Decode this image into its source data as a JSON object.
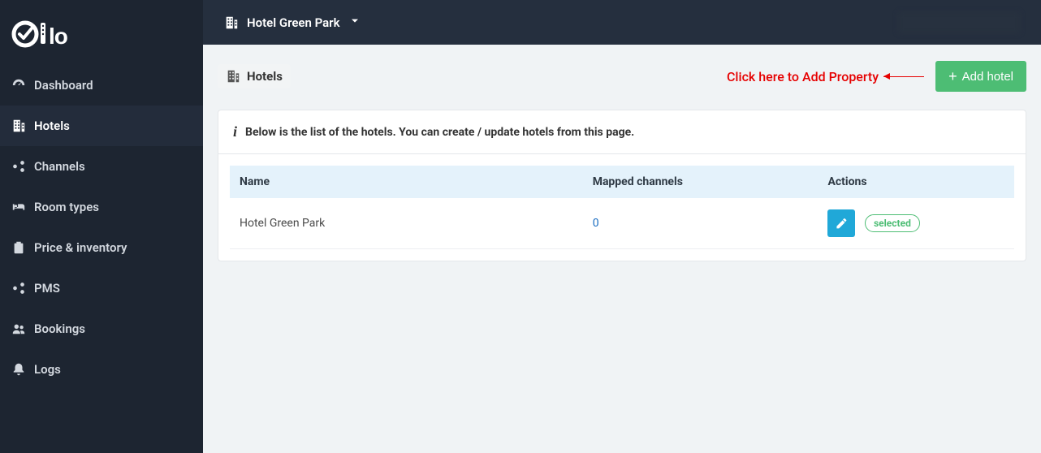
{
  "sidebar": {
    "items": [
      {
        "label": "Dashboard",
        "icon": "dashboard-icon"
      },
      {
        "label": "Hotels",
        "icon": "building-icon",
        "active": true
      },
      {
        "label": "Channels",
        "icon": "share-icon"
      },
      {
        "label": "Room types",
        "icon": "bed-icon"
      },
      {
        "label": "Price & inventory",
        "icon": "clipboard-icon"
      },
      {
        "label": "PMS",
        "icon": "share-icon"
      },
      {
        "label": "Bookings",
        "icon": "people-icon"
      },
      {
        "label": "Logs",
        "icon": "bell-icon"
      }
    ]
  },
  "topbar": {
    "selected_hotel": "Hotel Green Park"
  },
  "page": {
    "title": "Hotels",
    "annotation": "Click here to Add Property",
    "add_button_label": "Add hotel",
    "info_text": "Below is the list of the hotels. You can create / update hotels from this page."
  },
  "table": {
    "headers": {
      "name": "Name",
      "mapped": "Mapped channels",
      "actions": "Actions"
    },
    "rows": [
      {
        "name": "Hotel Green Park",
        "mapped": "0",
        "badge": "selected"
      }
    ]
  },
  "colors": {
    "accent_green": "#4dbd74",
    "accent_blue": "#20a8d8",
    "annotation_red": "#e60000"
  }
}
